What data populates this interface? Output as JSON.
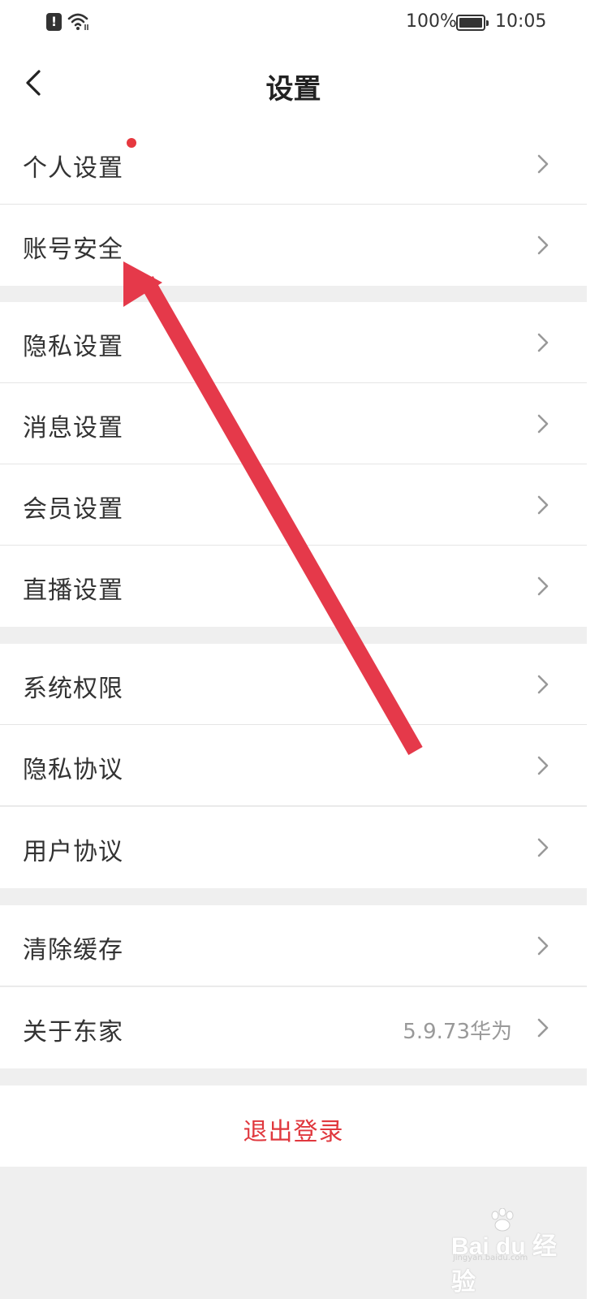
{
  "status_bar": {
    "alert": "!",
    "battery": "100%",
    "time": "10:05"
  },
  "header": {
    "title": "设置"
  },
  "sections": [
    {
      "items": [
        {
          "label": "个人设置",
          "badge": true
        },
        {
          "label": "账号安全"
        }
      ]
    },
    {
      "items": [
        {
          "label": "隐私设置"
        },
        {
          "label": "消息设置"
        },
        {
          "label": "会员设置"
        },
        {
          "label": "直播设置"
        }
      ]
    },
    {
      "items": [
        {
          "label": "系统权限"
        },
        {
          "label": "隐私协议"
        },
        {
          "label": "用户协议"
        }
      ]
    },
    {
      "items": [
        {
          "label": "清除缓存"
        },
        {
          "label": "关于东家",
          "value": "5.9.73华为"
        }
      ]
    }
  ],
  "logout": {
    "label": "退出登录"
  },
  "colors": {
    "accent": "#e0383e",
    "annotation_arrow": "#e5394a",
    "badge_dot": "#e6383f"
  },
  "watermark": {
    "text": "Bai du 经验",
    "sub": "jingyan.baidu.com"
  }
}
